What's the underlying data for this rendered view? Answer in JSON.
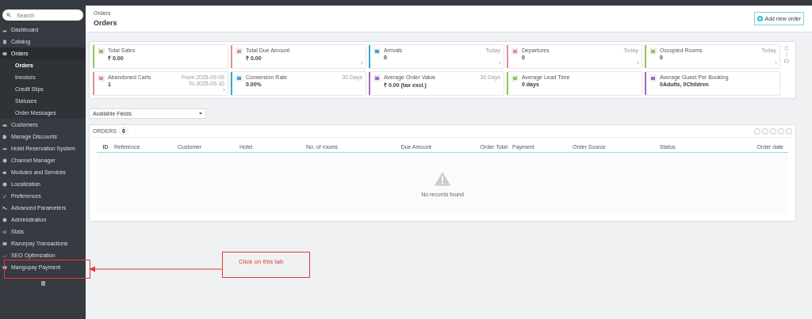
{
  "sidebar": {
    "search": {
      "placeholder": "Search"
    },
    "items": [
      {
        "label": "Dashboard",
        "selected": false
      },
      {
        "label": "Catalog",
        "selected": false
      },
      {
        "label": "Orders",
        "selected": true,
        "children": [
          {
            "label": "Orders",
            "selected": true
          },
          {
            "label": "Invoices",
            "selected": false
          },
          {
            "label": "Credit Slips",
            "selected": false
          },
          {
            "label": "Statuses",
            "selected": false
          },
          {
            "label": "Order Messages",
            "selected": false
          }
        ]
      },
      {
        "label": "Customers",
        "selected": false
      },
      {
        "label": "Manage Discounts",
        "selected": false
      },
      {
        "label": "Hotel Reservation System",
        "selected": false
      },
      {
        "label": "Channel Manager",
        "selected": false
      },
      {
        "label": "Modules and Services",
        "selected": false
      },
      {
        "label": "Localization",
        "selected": false
      },
      {
        "label": "Preferences",
        "selected": false
      },
      {
        "label": "Advanced Parameters",
        "selected": false
      },
      {
        "label": "Administration",
        "selected": false
      },
      {
        "label": "Stats",
        "selected": false
      },
      {
        "label": "Razorpay Transactions",
        "selected": false
      },
      {
        "label": "SEO Optimization",
        "selected": false
      },
      {
        "label": "Mangopay Payment",
        "selected": false
      }
    ]
  },
  "header": {
    "breadcrumb": "Orders",
    "title": "Orders",
    "add_button": "Add new order"
  },
  "kpis": [
    {
      "title": "Total Sales",
      "value": "₹ 0.00",
      "color": "#8bc954",
      "link": false
    },
    {
      "title": "Total Due Amount",
      "value": "₹ 0.00",
      "color": "#e08f95",
      "link": true
    },
    {
      "title": "Arrivals",
      "value": "0",
      "color": "#2eacce",
      "period": "Today",
      "link": true
    },
    {
      "title": "Departures",
      "value": "0",
      "color": "#e08f95",
      "period": "Today",
      "link": true
    },
    {
      "title": "Occupied Rooms",
      "value": "0",
      "color": "#8bc954",
      "period": "Today",
      "link": true
    },
    {
      "title": "Abandoned Carts",
      "value": "1",
      "color": "#e08f95",
      "period": "From 2025-09-09 To 2025-09-10",
      "link": true
    },
    {
      "title": "Conversion Rate",
      "value": "0.00%",
      "color": "#2eacce",
      "period": "30 Days",
      "link": false
    },
    {
      "title": "Average Order Value",
      "value": "₹ 0.00 (tax excl.)",
      "color": "#a569bd",
      "period": "30 Days",
      "link": false
    },
    {
      "title": "Average Lead Time",
      "value": "0 days",
      "color": "#8bc954",
      "link": false
    },
    {
      "title": "Average Guest Per Booking",
      "value": "0Adults, 0Children",
      "color": "#a569bd",
      "link": false
    }
  ],
  "available_fields": {
    "value": "Available Fields"
  },
  "orders": {
    "title": "ORDERS",
    "count": "0",
    "columns": [
      "ID",
      "Reference",
      "Customer",
      "Hotel",
      "No. of rooms",
      "Due Amount",
      "Order Total",
      "Payment",
      "Order Source",
      "Status",
      "Order date"
    ],
    "empty": "No records found"
  },
  "annotation": {
    "text": "Click on this tab"
  }
}
